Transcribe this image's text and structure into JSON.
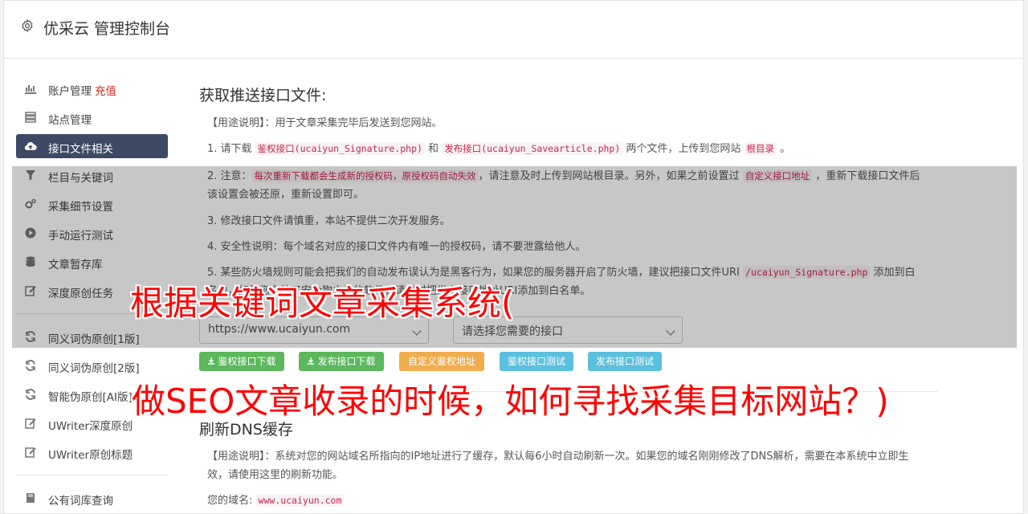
{
  "app": {
    "title": "优采云 管理控制台"
  },
  "sidebar": {
    "items": [
      {
        "label": "账户管理",
        "extra": "充值",
        "icon": "bar-chart-icon"
      },
      {
        "label": "站点管理",
        "icon": "server-icon"
      },
      {
        "label": "接口文件相关",
        "icon": "cloud-upload-icon",
        "active": true
      },
      {
        "label": "栏目与关键词",
        "icon": "filter-icon"
      },
      {
        "label": "采集细节设置",
        "icon": "gears-icon"
      },
      {
        "label": "手动运行测试",
        "icon": "play-circle-icon"
      },
      {
        "label": "文章暂存库",
        "icon": "database-icon"
      },
      {
        "label": "深度原创任务",
        "icon": "edit-icon"
      },
      {
        "label": "同义词伪原创[1版]",
        "icon": "refresh-icon"
      },
      {
        "label": "同义词伪原创[2版]",
        "icon": "refresh-icon"
      },
      {
        "label": "智能伪原创[AI版]",
        "icon": "refresh-icon"
      },
      {
        "label": "UWriter深度原创",
        "icon": "edit-icon"
      },
      {
        "label": "UWriter原创标题",
        "icon": "edit-icon"
      },
      {
        "label": "公有词库查询",
        "icon": "book-icon"
      }
    ]
  },
  "section1": {
    "heading": "获取推送接口文件:",
    "usage_prefix": "【用途说明】：",
    "usage_text": "用于文章采集完毕后发送到您网站。",
    "step1": {
      "a": "1. 请下载 ",
      "link1": "鉴权接口(ucaiyun_Signature.php)",
      "b": " 和 ",
      "link2": "发布接口(ucaiyun_Savearticle.php)",
      "c": " 两个文件，上传到您网站 ",
      "link3": "根目录",
      "d": " 。"
    },
    "step2": {
      "a": "2. 注意：",
      "code1": "每次重新下载都会生成新的授权码，原授权码自动失效",
      "b": "，请注意及时上传到网站根目录。另外，如果之前设置过 ",
      "code2": "自定义接口地址",
      "c": " ，重新下载接口文件后该设置会被还原，重新设置即可。"
    },
    "step3": "3. 修改接口文件请慎重，本站不提供二次开发服务。",
    "step4": "4. 安全性说明：每个域名对应的接口文件内有唯一的授权码，请不要泄露给他人。",
    "step5": {
      "a": "5. 某些防火墙规则可能会把我们的自动发布误认为是黑客行为，如果您的服务器开启了防火墙，建议把接口文件URI ",
      "code": "/ucaiyun_Signature.php",
      "b": " 添加到白名单，如果您安装了安全狗之类的软件，请同时把发布接口地址URI添加到白名单。"
    },
    "site_select": "https://www.ucaiyun.com",
    "api_select": "请选择您需要的接口",
    "buttons": {
      "download_sig": "鉴权接口下载",
      "download_save": "发布接口下载",
      "custom_sig": "自定义鉴权地址",
      "test_sig": "鉴权接口测试",
      "test_save": "发布接口测试"
    }
  },
  "section2": {
    "heading": "刷新DNS缓存",
    "usage_prefix": "【用途说明】：",
    "usage_text": "系统对您的网站域名所指向的IP地址进行了缓存，默认每6小时自动刷新一次。如果您的域名刚刚修改了DNS解析，需要在本系统中立即生效，请使用这里的刷新功能。",
    "domain_label": "您的域名: ",
    "domain_value": "www.ucaiyun.com"
  },
  "overlay_text": {
    "line1": "根据关键词文章采集系统(",
    "line2": "做SEO文章收录的时候，如何寻找采集目标网站？)"
  },
  "colors": {
    "accent_dark": "#3c4a63",
    "green": "#5cb85c",
    "orange": "#f0ad4e",
    "blue": "#5bc0de",
    "red": "#ff0000"
  }
}
